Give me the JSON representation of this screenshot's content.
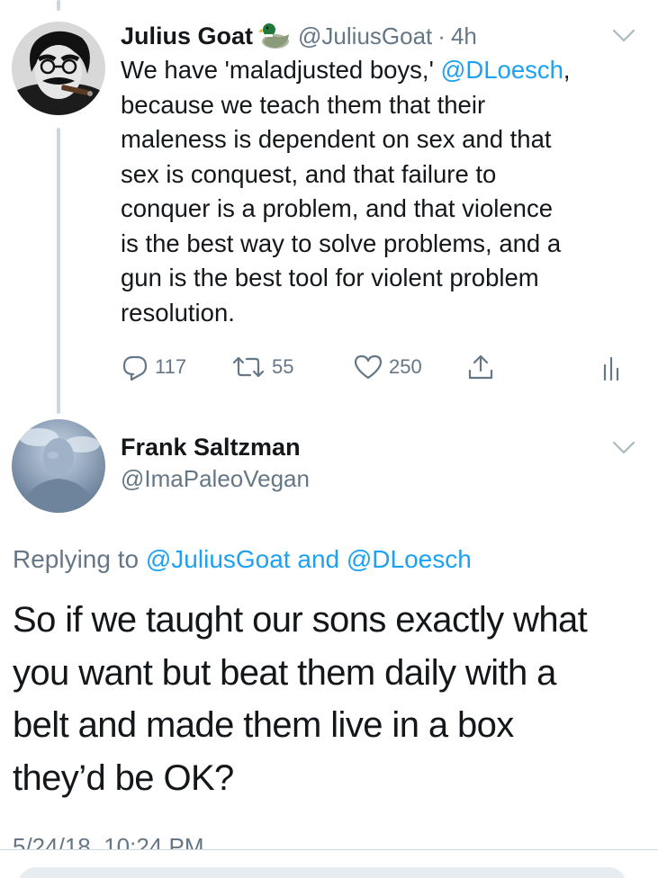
{
  "tweet1": {
    "display_name": "Julius Goat",
    "emoji_icon": "duck-icon",
    "handle": "@JuliusGoat",
    "separator": "·",
    "time": "4h",
    "body_parts": [
      "We have 'maladjusted boys,' ",
      "@DLoesch",
      ",\nbecause we teach them that their\nmaleness is dependent on sex and that\nsex is conquest, and that failure to\nconquer is a problem, and that violence\nis the best way to solve problems, and a\ngun is the best tool for violent problem\nresolution."
    ],
    "actions": {
      "reply_count": "117",
      "retweet_count": "55",
      "like_count": "250"
    }
  },
  "tweet2": {
    "display_name": "Frank Saltzman",
    "handle": "@ImaPaleoVegan",
    "replying_prefix": "Replying to ",
    "replying_to_1": "@JuliusGoat",
    "replying_and": " and ",
    "replying_to_2": "@DLoesch",
    "body": "So if we taught our sons exactly what\nyou want but beat them daily with a\nbelt and made them live in a box\nthey’d be OK?",
    "timestamp": "5/24/18, 10:24 PM"
  },
  "colors": {
    "link": "#1da1f2",
    "secondary_text": "#657786",
    "primary_text": "#14171a",
    "divider": "#ccd6dd"
  }
}
